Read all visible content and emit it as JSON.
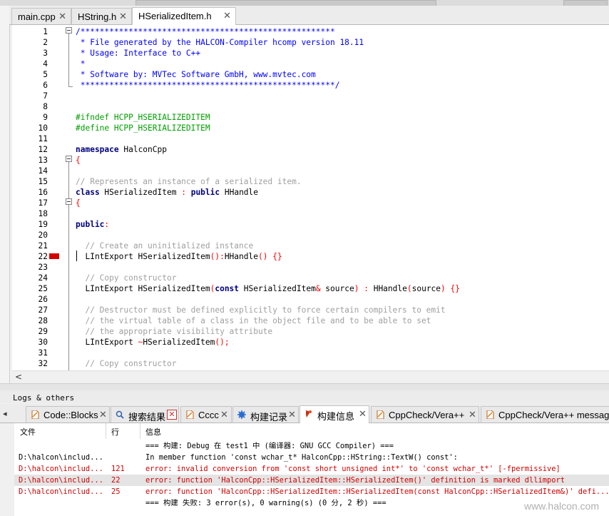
{
  "editor_tabs": [
    {
      "label": "main.cpp",
      "close": "✕"
    },
    {
      "label": "HString.h",
      "close": "✕"
    },
    {
      "label": "HSerializedItem.h",
      "close": "✕"
    }
  ],
  "code_lines": [
    {
      "n": "1",
      "segs": [
        [
          "c-doc",
          "/*****************************************************"
        ]
      ]
    },
    {
      "n": "2",
      "segs": [
        [
          "c-doc",
          " * File generated by the HALCON-Compiler hcomp version 18.11"
        ]
      ]
    },
    {
      "n": "3",
      "segs": [
        [
          "c-doc",
          " * Usage: Interface to C++"
        ]
      ]
    },
    {
      "n": "4",
      "segs": [
        [
          "c-doc",
          " *"
        ]
      ]
    },
    {
      "n": "5",
      "segs": [
        [
          "c-doc",
          " * Software by: MVTec Software GmbH, www.mvtec.com"
        ]
      ]
    },
    {
      "n": "6",
      "segs": [
        [
          "c-doc",
          " *****************************************************/"
        ]
      ]
    },
    {
      "n": "7",
      "segs": []
    },
    {
      "n": "8",
      "segs": []
    },
    {
      "n": "9",
      "segs": [
        [
          "c-pp",
          "#ifndef HCPP_HSERIALIZEDITEM"
        ]
      ]
    },
    {
      "n": "10",
      "segs": [
        [
          "c-pp",
          "#define HCPP_HSERIALIZEDITEM"
        ]
      ]
    },
    {
      "n": "11",
      "segs": []
    },
    {
      "n": "12",
      "segs": [
        [
          "c-kw",
          "namespace"
        ],
        [
          "c-id",
          " HalconCpp"
        ]
      ]
    },
    {
      "n": "13",
      "segs": [
        [
          "c-op",
          "{"
        ]
      ]
    },
    {
      "n": "14",
      "segs": []
    },
    {
      "n": "15",
      "segs": [
        [
          "c-com",
          "// Represents an instance of a serialized item."
        ]
      ]
    },
    {
      "n": "16",
      "segs": [
        [
          "c-kw",
          "class"
        ],
        [
          "c-id",
          " HSerializedItem "
        ],
        [
          "c-op",
          ":"
        ],
        [
          "c-id",
          " "
        ],
        [
          "c-kw",
          "public"
        ],
        [
          "c-id",
          " HHandle"
        ]
      ]
    },
    {
      "n": "17",
      "segs": [
        [
          "c-op",
          "{"
        ]
      ]
    },
    {
      "n": "18",
      "segs": []
    },
    {
      "n": "19",
      "segs": [
        [
          "c-kw",
          "public"
        ],
        [
          "c-op",
          ":"
        ]
      ]
    },
    {
      "n": "20",
      "segs": []
    },
    {
      "n": "21",
      "segs": [
        [
          "c-com",
          "  // Create an uninitialized instance"
        ]
      ]
    },
    {
      "n": "22",
      "segs": [
        [
          "c-id",
          "  LIntExport HSerializedItem"
        ],
        [
          "c-op",
          "():"
        ],
        [
          "c-id",
          "HHandle"
        ],
        [
          "c-op",
          "()"
        ],
        [
          "c-id",
          " "
        ],
        [
          "c-op",
          "{}"
        ]
      ]
    },
    {
      "n": "23",
      "segs": []
    },
    {
      "n": "24",
      "segs": [
        [
          "c-com",
          "  // Copy constructor"
        ]
      ]
    },
    {
      "n": "25",
      "segs": [
        [
          "c-id",
          "  LIntExport HSerializedItem"
        ],
        [
          "c-op",
          "("
        ],
        [
          "c-kw",
          "const"
        ],
        [
          "c-id",
          " HSerializedItem"
        ],
        [
          "c-op",
          "&"
        ],
        [
          "c-id",
          " source"
        ],
        [
          "c-op",
          ")"
        ],
        [
          "c-id",
          " "
        ],
        [
          "c-op",
          ":"
        ],
        [
          "c-id",
          " HHandle"
        ],
        [
          "c-op",
          "("
        ],
        [
          "c-id",
          "source"
        ],
        [
          "c-op",
          ")"
        ],
        [
          "c-id",
          " "
        ],
        [
          "c-op",
          "{}"
        ]
      ]
    },
    {
      "n": "26",
      "segs": []
    },
    {
      "n": "27",
      "segs": [
        [
          "c-com",
          "  // Destructor must be defined explicitly to force certain compilers to emit"
        ]
      ]
    },
    {
      "n": "28",
      "segs": [
        [
          "c-com",
          "  // the virtual table of a class in the object file and to be able to set"
        ]
      ]
    },
    {
      "n": "29",
      "segs": [
        [
          "c-com",
          "  // the appropriate visibility attribute"
        ]
      ]
    },
    {
      "n": "30",
      "segs": [
        [
          "c-id",
          "  LIntExport "
        ],
        [
          "c-op",
          "~"
        ],
        [
          "c-id",
          "HSerializedItem"
        ],
        [
          "c-op",
          "();"
        ]
      ]
    },
    {
      "n": "31",
      "segs": []
    },
    {
      "n": "32",
      "segs": [
        [
          "c-com",
          "  // Copy constructor"
        ]
      ]
    }
  ],
  "scroll_left": "<",
  "logs_title": "Logs & others",
  "bottom_tabs": [
    {
      "label": "Code::Blocks",
      "icon": "document-icon"
    },
    {
      "label": "搜索结果",
      "icon": "search-icon"
    },
    {
      "label": "Cccc",
      "icon": "document-icon"
    },
    {
      "label": "构建记录",
      "icon": "gear-icon"
    },
    {
      "label": "构建信息",
      "icon": "pin-icon"
    },
    {
      "label": "CppCheck/Vera++",
      "icon": "document-icon"
    },
    {
      "label": "CppCheck/Vera++ messages",
      "icon": "document-icon"
    }
  ],
  "close_glyph": "✕",
  "nav_left": "◂",
  "columns": {
    "file": "文件",
    "line": "行",
    "message": "信息"
  },
  "messages": [
    {
      "file": "",
      "line": "",
      "msg": "=== 构建: Debug 在 test1 中 (编译器: GNU GCC Compiler) ===",
      "type": "normal"
    },
    {
      "file": "D:\\halcon\\includ...",
      "line": "",
      "msg": "In member function 'const wchar_t* HalconCpp::HString::TextW() const':",
      "type": "normal"
    },
    {
      "file": "D:\\halcon\\includ...",
      "line": "121",
      "msg": "error: invalid conversion from 'const short unsigned int*' to 'const wchar_t*' [-fpermissive]",
      "type": "error"
    },
    {
      "file": "D:\\halcon\\includ...",
      "line": "22",
      "msg": "error: function 'HalconCpp::HSerializedItem::HSerializedItem()' definition is marked dllimport",
      "type": "error-selected"
    },
    {
      "file": "D:\\halcon\\includ...",
      "line": "25",
      "msg": "error: function 'HalconCpp::HSerializedItem::HSerializedItem(const HalconCpp::HSerializedItem&)' defi...",
      "type": "error"
    },
    {
      "file": "",
      "line": "",
      "msg": "=== 构建 失败: 3 error(s), 0 warning(s) (0 分, 2 秒) ===",
      "type": "normal"
    }
  ],
  "watermark": "www.halcon.com"
}
